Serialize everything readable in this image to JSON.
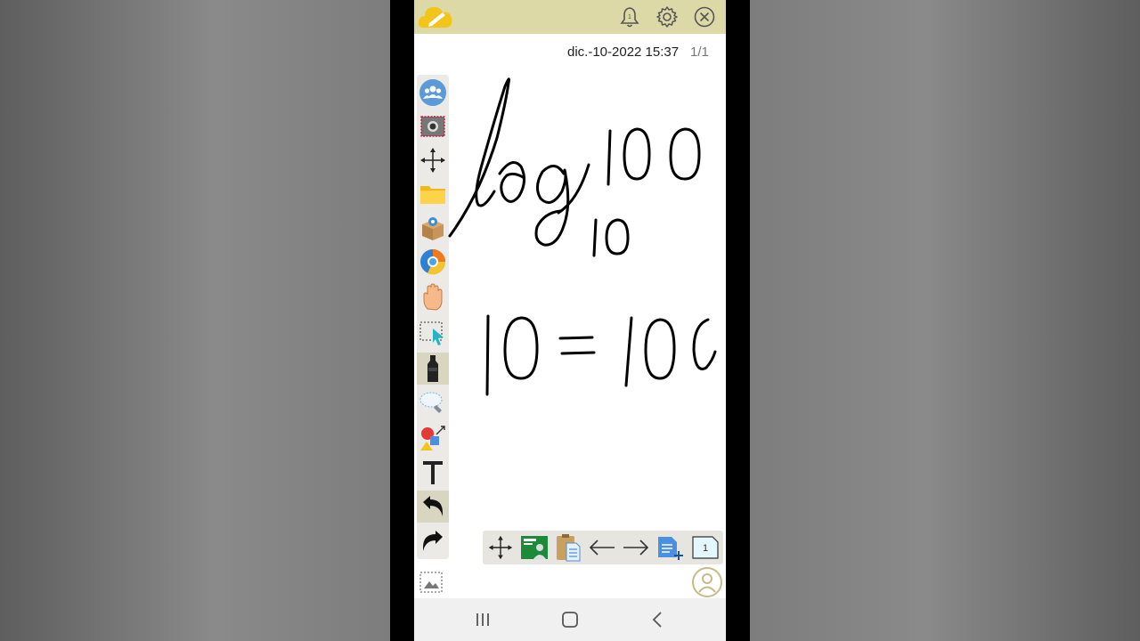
{
  "header": {
    "notification_count": "1"
  },
  "status": {
    "datetime": "dic.-10-2022 15:37",
    "page_indicator": "1/1"
  },
  "toolbar": {
    "tools": [
      {
        "icon": "group-icon"
      },
      {
        "icon": "camera-capture-icon"
      },
      {
        "icon": "move-arrows-icon"
      },
      {
        "icon": "folder-icon"
      },
      {
        "icon": "package-box-icon"
      },
      {
        "icon": "browser-icon"
      },
      {
        "icon": "hand-pan-icon"
      },
      {
        "icon": "select-cursor-icon"
      },
      {
        "icon": "marker-pen-icon"
      },
      {
        "icon": "eraser-icon"
      },
      {
        "icon": "shapes-icon"
      },
      {
        "icon": "text-tool-icon"
      },
      {
        "icon": "undo-icon"
      },
      {
        "icon": "redo-icon"
      }
    ]
  },
  "bottom_bar": {
    "page_thumb_label": "1"
  },
  "colors": {
    "topbar": "#ddd9a7",
    "accent_yellow": "#f3c51b",
    "ink": "#000000"
  }
}
